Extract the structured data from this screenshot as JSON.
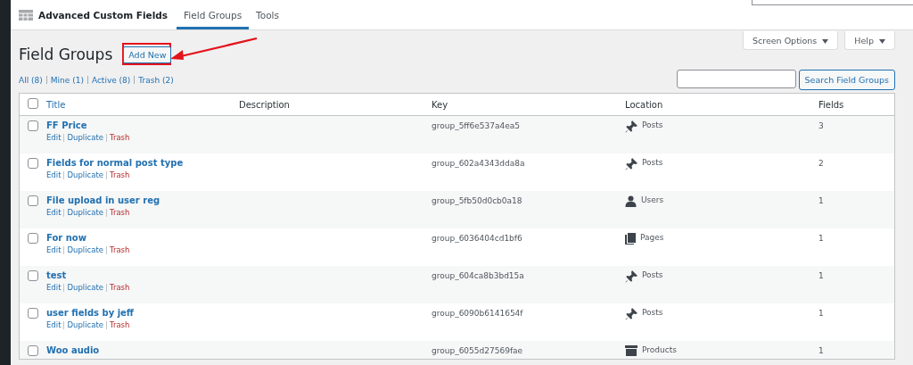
{
  "header": {
    "plugin_title": "Advanced Custom Fields",
    "tabs": [
      {
        "label": "Field Groups",
        "selected": true
      },
      {
        "label": "Tools",
        "selected": false
      }
    ]
  },
  "screen_buttons": [
    "Screen Options",
    "Help"
  ],
  "page_title": "Field Groups",
  "add_new": "Add New",
  "filters": [
    "All (8)",
    "Mine (1)",
    "Active (8)",
    "Trash (2)"
  ],
  "search": {
    "button": "Search Field Groups"
  },
  "table": {
    "select_all_checked": false,
    "columns": [
      "Title",
      "Description",
      "Key",
      "Location",
      "Fields"
    ],
    "rows": [
      {
        "title": "FF Price",
        "actions": [
          "Edit",
          "Duplicate",
          "Trash"
        ],
        "key": "group_5ff6e537a4ea5",
        "location": "Posts",
        "kind": "post",
        "fields": "3",
        "checked": false
      },
      {
        "title": "Fields for normal post type",
        "actions": [
          "Edit",
          "Duplicate",
          "Trash"
        ],
        "key": "group_602a4343dda8a",
        "location": "Posts",
        "kind": "post",
        "fields": "2",
        "checked": false
      },
      {
        "title": "File upload in user reg",
        "actions": [
          "Edit",
          "Duplicate",
          "Trash"
        ],
        "key": "group_5fb50d0cb0a18",
        "location": "Users",
        "kind": "user",
        "fields": "1",
        "checked": false
      },
      {
        "title": "For now",
        "actions": [
          "Edit",
          "Duplicate",
          "Trash"
        ],
        "key": "group_6036404cd1bf6",
        "location": "Pages",
        "kind": "page",
        "fields": "1",
        "checked": false
      },
      {
        "title": "test",
        "actions": [
          "Edit",
          "Duplicate",
          "Trash"
        ],
        "key": "group_604ca8b3bd15a",
        "location": "Posts",
        "kind": "post",
        "fields": "1",
        "checked": false
      },
      {
        "title": "user fields by jeff",
        "actions": [
          "Edit",
          "Duplicate",
          "Trash"
        ],
        "key": "group_6090b6141654f",
        "location": "Posts",
        "kind": "post",
        "fields": "1",
        "checked": false
      },
      {
        "title": "Woo audio",
        "key": "group_6055d27569fae",
        "location": "Products",
        "kind": "product",
        "fields": "1",
        "checked": false
      }
    ]
  }
}
